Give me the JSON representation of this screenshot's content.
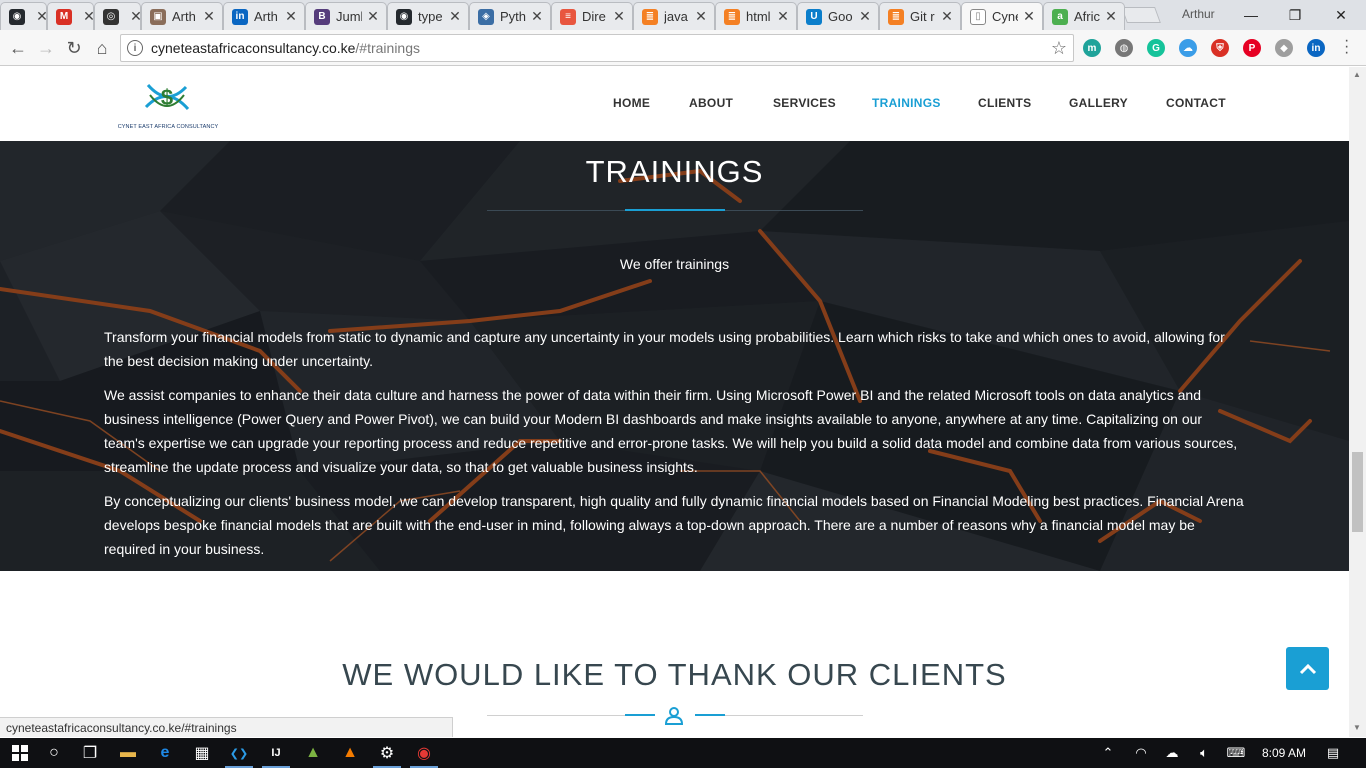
{
  "browser": {
    "tabs": [
      {
        "label": "",
        "icon": "github-icon",
        "color": "#24292e",
        "glyph": "◉"
      },
      {
        "label": "",
        "icon": "gmail-icon",
        "color": "#d93025",
        "glyph": "M"
      },
      {
        "label": "",
        "icon": "circle-icon",
        "color": "#333333",
        "glyph": "◎"
      },
      {
        "label": "Arth",
        "icon": "photo-icon",
        "color": "#8a6d5a",
        "glyph": "▣"
      },
      {
        "label": "Arth",
        "icon": "linkedin-icon",
        "color": "#0a66c2",
        "glyph": "in"
      },
      {
        "label": "Juml",
        "icon": "bootstrap-icon",
        "color": "#563d7c",
        "glyph": "B"
      },
      {
        "label": "type",
        "icon": "github-icon",
        "color": "#24292e",
        "glyph": "◉"
      },
      {
        "label": "Pyth",
        "icon": "python-icon",
        "color": "#3b6ea5",
        "glyph": "◈"
      },
      {
        "label": "Dire",
        "icon": "stack-icon",
        "color": "#e8563f",
        "glyph": "≡"
      },
      {
        "label": "java",
        "icon": "stackoverflow-icon",
        "color": "#f48024",
        "glyph": "≣"
      },
      {
        "label": "html",
        "icon": "stackoverflow-icon",
        "color": "#f48024",
        "glyph": "≣"
      },
      {
        "label": "Goo",
        "icon": "udemy-icon",
        "color": "#0b7ecb",
        "glyph": "U"
      },
      {
        "label": "Git r",
        "icon": "stackoverflow-icon",
        "color": "#f48024",
        "glyph": "≣"
      },
      {
        "label": "Cyne",
        "icon": "document-icon",
        "color": "#ffffff",
        "glyph": "▯",
        "active": true
      },
      {
        "label": "Afric",
        "icon": "africa-icon",
        "color": "#4caf50",
        "glyph": "a"
      }
    ],
    "profile_name": "Arthur",
    "url_host": "cyneteastafricaconsultancy.co.ke",
    "url_path": "/#trainings",
    "status_url": "cyneteastafricaconsultancy.co.ke/#trainings",
    "extensions": [
      {
        "icon": "m-extension-icon",
        "color": "#1fa39a",
        "glyph": "m"
      },
      {
        "icon": "globe-extension-icon",
        "color": "#777777",
        "glyph": "◍"
      },
      {
        "icon": "grammarly-icon",
        "color": "#15c39a",
        "glyph": "G"
      },
      {
        "icon": "cloud-extension-icon",
        "color": "#3a9de8",
        "glyph": "☁"
      },
      {
        "icon": "shield-extension-icon",
        "color": "#d93025",
        "glyph": "⛨"
      },
      {
        "icon": "pinterest-icon",
        "color": "#e60023",
        "glyph": "P"
      },
      {
        "icon": "puzzle-extension-icon",
        "color": "#9e9e9e",
        "glyph": "◆"
      },
      {
        "icon": "linkedin-extension-icon",
        "color": "#0a66c2",
        "glyph": "in"
      }
    ]
  },
  "site": {
    "logo_text": "CYNET EAST AFRICA CONSULTANCY",
    "nav": [
      "HOME",
      "ABOUT",
      "SERVICES",
      "TRAININGS",
      "CLIENTS",
      "GALLERY",
      "CONTACT"
    ],
    "active_nav": "TRAININGS",
    "trainings": {
      "title": "TRAININGS",
      "subtitle": "We offer trainings",
      "paragraphs": [
        "Transform your financial models from static to dynamic and capture any uncertainty in your models using probabilities. Learn which risks to take and which ones to avoid, allowing for the best decision making under uncertainty.",
        "We assist companies to enhance their data culture and harness the power of data within their firm. Using Microsoft Power BI and the related Microsoft tools on data analytics and business intelligence (Power Query and Power Pivot), we can build your Modern BI dashboards and make insights available to anyone, anywhere at any time. Capitalizing on our team's expertise we can upgrade your reporting process and reduce repetitive and error-prone tasks. We will help you build a solid data model and combine data from various sources, streamline the update process and visualize your data, so that to get valuable business insights.",
        "By conceptualizing our clients' business model, we can develop transparent, high quality and fully dynamic financial models based on Financial Modeling best practices. Financial Arena develops bespoke financial models that are built with the end-user in mind, following always a top-down approach. There are a number of reasons why a financial model may be required in your business."
      ]
    },
    "clients_title": "WE WOULD LIKE TO THANK OUR CLIENTS",
    "accent_color": "#1a9fd4"
  },
  "taskbar": {
    "apps": [
      {
        "icon": "file-explorer-icon",
        "glyph": "▬",
        "color": "#e8b64c"
      },
      {
        "icon": "edge-icon",
        "glyph": "e",
        "color": "#1e88e5"
      },
      {
        "icon": "store-icon",
        "glyph": "▦",
        "color": "#ffffff"
      },
      {
        "icon": "vscode-icon",
        "glyph": "❮❯",
        "color": "#2b9be6"
      },
      {
        "icon": "intellij-icon",
        "glyph": "IJ",
        "color": "#ffffff"
      },
      {
        "icon": "android-studio-icon",
        "glyph": "▲",
        "color": "#7cb342"
      },
      {
        "icon": "vlc-icon",
        "glyph": "▲",
        "color": "#f57c00"
      },
      {
        "icon": "settings-icon",
        "glyph": "⚙",
        "color": "#ffffff"
      },
      {
        "icon": "chrome-icon",
        "glyph": "◉",
        "color": "#e53935"
      }
    ],
    "clock": "8:09 AM"
  }
}
